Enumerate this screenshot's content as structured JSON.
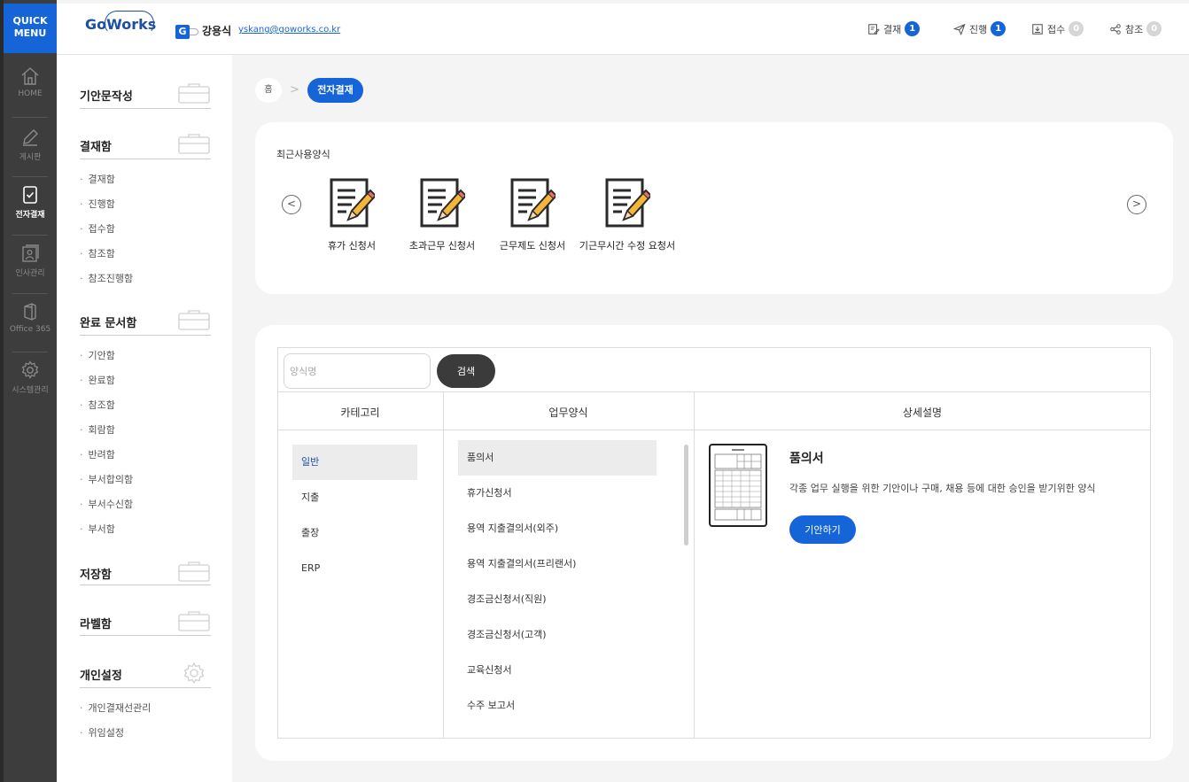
{
  "quick_menu": {
    "line1": "QUICK",
    "line2": "MENU"
  },
  "rail": [
    {
      "label": "HOME",
      "icon": "home-icon"
    },
    {
      "label": "게시판",
      "icon": "pencil-icon"
    },
    {
      "label": "전자결재",
      "icon": "approval-check-icon"
    },
    {
      "label": "인사관리",
      "icon": "person-card-icon"
    },
    {
      "label": "Office 365",
      "icon": "office-icon"
    },
    {
      "label": "시스템관리",
      "icon": "gear-icon"
    }
  ],
  "header": {
    "logo": "GoWorks",
    "org_badge": "G",
    "user_name": "강용식",
    "user_email": "yskang@goworks.co.kr",
    "stats": [
      {
        "label": "결재",
        "count": "1",
        "icon": "document-pen-icon"
      },
      {
        "label": "진행",
        "count": "1",
        "icon": "send-icon"
      },
      {
        "label": "접수",
        "count": "0",
        "icon": "inbox-download-icon"
      },
      {
        "label": "참조",
        "count": "0",
        "icon": "share-icon"
      }
    ]
  },
  "subnav": {
    "sections": [
      {
        "title": "기안문작성"
      },
      {
        "title": "결재함",
        "items": [
          "결재함",
          "진행함",
          "접수함",
          "참조함",
          "참조진행함"
        ]
      },
      {
        "title": "완료 문서함",
        "items": [
          "기안함",
          "완료함",
          "참조함",
          "회람함",
          "반려함",
          "부서합의함",
          "부서수신함",
          "부서함"
        ]
      },
      {
        "title": "저장함"
      },
      {
        "title": "라벨함"
      },
      {
        "title": "개인설정",
        "items": [
          "개인결재선관리",
          "위임설정"
        ]
      }
    ]
  },
  "breadcrumb": {
    "home": "홈",
    "current": "전자결재"
  },
  "recent": {
    "label": "최근사용양식",
    "prev": "<",
    "next": ">",
    "forms": [
      "휴가 신청서",
      "초과근무 신청서",
      "근무제도 신청서",
      "기근무시간 수정 요청서"
    ]
  },
  "search": {
    "placeholder": "양식명",
    "button": "검색"
  },
  "table": {
    "headers": [
      "카테고리",
      "업무양식",
      "상세설명"
    ],
    "categories": [
      "일반",
      "지출",
      "출장",
      "ERP"
    ],
    "selected_category": "일반",
    "forms": [
      "품의서",
      "휴가신청서",
      "용역 지출결의서(외주)",
      "용역 지출결의서(프리랜서)",
      "경조금신청서(직원)",
      "경조금신청서(고객)",
      "교육신청서",
      "수주 보고서"
    ],
    "selected_form": "품의서"
  },
  "detail": {
    "title": "품의서",
    "description": "각종 업무 실행을 위한 기안이나 구매, 채용 등에 대한 승인을 받기위한 양식",
    "button": "기안하기"
  },
  "colors": {
    "accent": "#1565d8",
    "rail_bg": "#3d3d3d",
    "dark_button": "#3b3b3b",
    "badge_zero": "#d6d6d6"
  }
}
